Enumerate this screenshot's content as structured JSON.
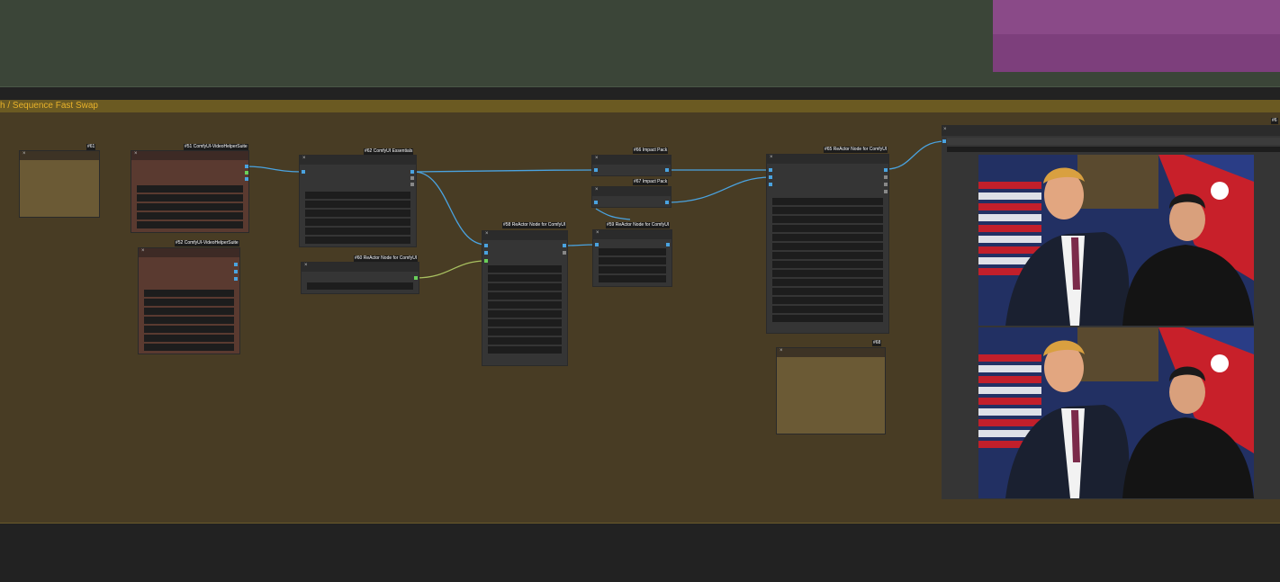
{
  "group": {
    "title": "h / Sequence Fast Swap"
  },
  "nodes": [
    {
      "id": "n0",
      "title": "#61"
    },
    {
      "id": "n1",
      "title": "#51 ComfyUI-VideoHelperSuite"
    },
    {
      "id": "n2",
      "title": "#52 ComfyUI-VideoHelperSuite"
    },
    {
      "id": "n3",
      "title": "#62 ComfyUI Essentials"
    },
    {
      "id": "n4",
      "title": "#60 ReActor Node for ComfyUI"
    },
    {
      "id": "n5",
      "title": "#58 ReActor Node for ComfyUI"
    },
    {
      "id": "n6",
      "title": "#66 Impact Pack"
    },
    {
      "id": "n7",
      "title": "#67 Impact Pack"
    },
    {
      "id": "n8",
      "title": "#59 ReActor Node for ComfyUI"
    },
    {
      "id": "n9",
      "title": "#65 ReActor Node for ComfyUI"
    },
    {
      "id": "n10",
      "title": "#68"
    },
    {
      "id": "n11",
      "title": "#6"
    }
  ],
  "colors": {
    "canvas": "#222222",
    "group_main": "#483c24",
    "group_title": "#e8b22a",
    "link_image": "#4aa3e0",
    "link_face": "#a8c060"
  },
  "icons": [
    "node-close-icon",
    "slot-dot-icon"
  ]
}
